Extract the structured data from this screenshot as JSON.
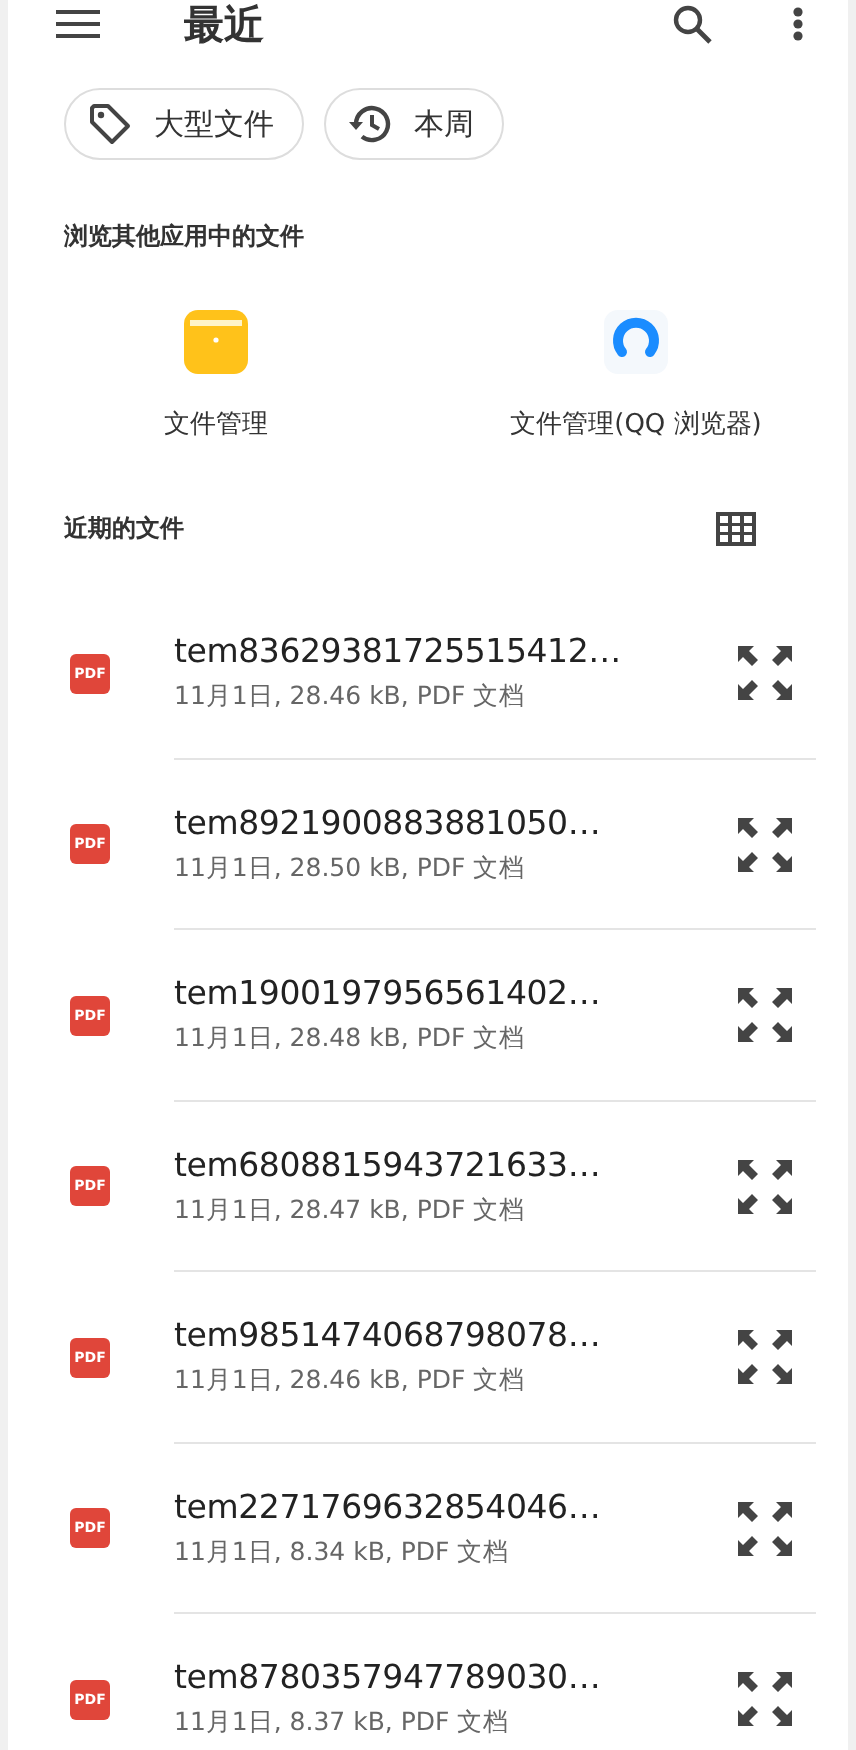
{
  "app_bar": {
    "title": "最近"
  },
  "chips": [
    {
      "kind": "tag",
      "label": "大型文件"
    },
    {
      "kind": "history",
      "label": "本周"
    }
  ],
  "other_apps": {
    "heading": "浏览其他应用中的文件",
    "apps": [
      {
        "kind": "folder",
        "label": "文件管理"
      },
      {
        "kind": "browser",
        "label": "文件管理(QQ 浏览器)"
      }
    ]
  },
  "recent": {
    "heading": "近期的文件",
    "files": [
      {
        "badge": "PDF",
        "name": "tem83629381725515412…",
        "details": "11月1日, 28.46 kB, PDF 文档"
      },
      {
        "badge": "PDF",
        "name": "tem8921900883881050…",
        "details": "11月1日, 28.50 kB, PDF 文档"
      },
      {
        "badge": "PDF",
        "name": "tem1900197956561402…",
        "details": "11月1日, 28.48 kB, PDF 文档"
      },
      {
        "badge": "PDF",
        "name": "tem6808815943721633…",
        "details": "11月1日, 28.47 kB, PDF 文档"
      },
      {
        "badge": "PDF",
        "name": "tem9851474068798078…",
        "details": "11月1日, 28.46 kB, PDF 文档"
      },
      {
        "badge": "PDF",
        "name": "tem2271769632854046…",
        "details": "11月1日, 8.34 kB, PDF 文档"
      },
      {
        "badge": "PDF",
        "name": "tem8780357947789030…",
        "details": "11月1日, 8.37 kB, PDF 文档"
      }
    ]
  }
}
